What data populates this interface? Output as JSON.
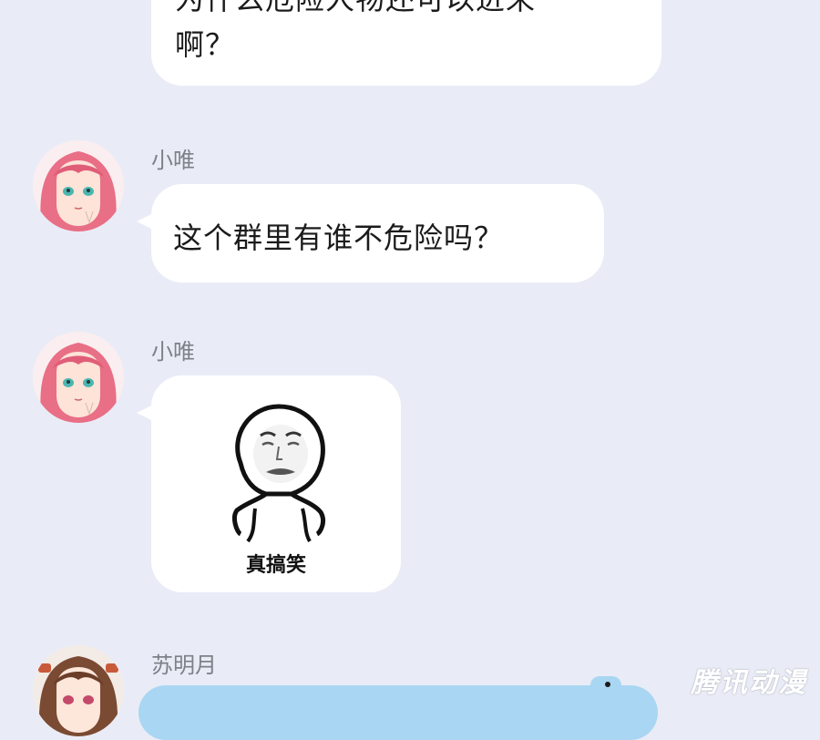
{
  "messages": [
    {
      "lines": [
        "为什么危险人物还可以进来",
        "啊？"
      ]
    },
    {
      "sender": "小唯",
      "text": "这个群里有谁不危险吗？"
    },
    {
      "sender": "小唯",
      "sticker_caption": "真搞笑"
    },
    {
      "sender": "苏明月"
    }
  ],
  "watermark": "腾讯动漫",
  "icons": {
    "avatar_1": "pink-hair-girl-avatar",
    "avatar_2": "pink-hair-girl-avatar",
    "avatar_3": "brown-hair-girl-avatar",
    "sticker": "meme-face-sticker"
  },
  "colors": {
    "background": "#e9ecf6",
    "bubble_white": "#ffffff",
    "bubble_blue": "#a9d6f2",
    "name_text": "#7d8087"
  }
}
